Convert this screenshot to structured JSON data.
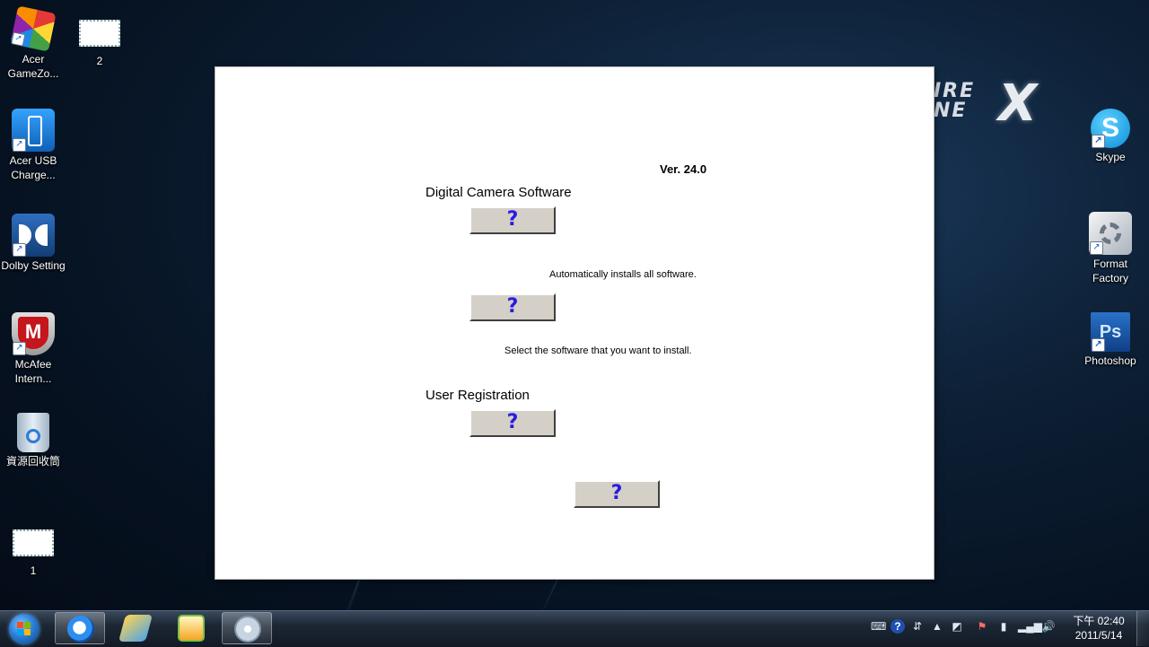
{
  "desktop": {
    "icons_left": [
      {
        "name": "acer-gamezone-shortcut",
        "label": "Acer GameZo...",
        "icon": "rubik-cube-icon",
        "shortcut": true
      },
      {
        "name": "image-file-2",
        "label": "2",
        "icon": "image-file-icon",
        "shortcut": false
      },
      {
        "name": "acer-usb-charge-shortcut",
        "label": "Acer USB Charge...",
        "icon": "usb-charge-icon",
        "shortcut": true
      },
      {
        "name": "dolby-setting-shortcut",
        "label": "Dolby Setting",
        "icon": "dolby-icon",
        "shortcut": true
      },
      {
        "name": "mcafee-shortcut",
        "label": "McAfee Intern...",
        "icon": "mcafee-shield-icon",
        "shortcut": true
      },
      {
        "name": "recycle-bin",
        "label": "資源回收筒",
        "icon": "recycle-bin-icon",
        "shortcut": false
      },
      {
        "name": "image-file-1",
        "label": "1",
        "icon": "image-file-icon",
        "shortcut": false
      }
    ],
    "icons_right": [
      {
        "name": "skype-shortcut",
        "label": "Skype",
        "icon": "skype-icon",
        "shortcut": true
      },
      {
        "name": "format-factory-shortcut",
        "label": "Format Factory",
        "icon": "format-factory-icon",
        "shortcut": true
      },
      {
        "name": "photoshop-shortcut",
        "label": "Photoshop",
        "icon": "photoshop-icon",
        "shortcut": true
      }
    ]
  },
  "installer": {
    "version": "Ver. 24.0",
    "section_camera": "Digital Camera Software",
    "auto_install_text": "Automatically installs all software.",
    "select_text": "Select the software that you want to install.",
    "section_registration": "User Registration",
    "button_glyph": "?"
  },
  "taskbar": {
    "pinned": [
      {
        "name": "internet-explorer-button",
        "icon": "internet-explorer-icon",
        "active": true
      },
      {
        "name": "pinned-app-button",
        "icon": "pen-app-icon",
        "active": false
      },
      {
        "name": "pps-button",
        "icon": "pps-icon",
        "active": false
      },
      {
        "name": "installer-taskbar-button",
        "icon": "installer-disc-icon",
        "active": true
      }
    ],
    "clock_time": "下午 02:40",
    "clock_date": "2011/5/14"
  },
  "colors": {
    "button_face": "#d4d0c8",
    "question_mark": "#2a1be0"
  }
}
